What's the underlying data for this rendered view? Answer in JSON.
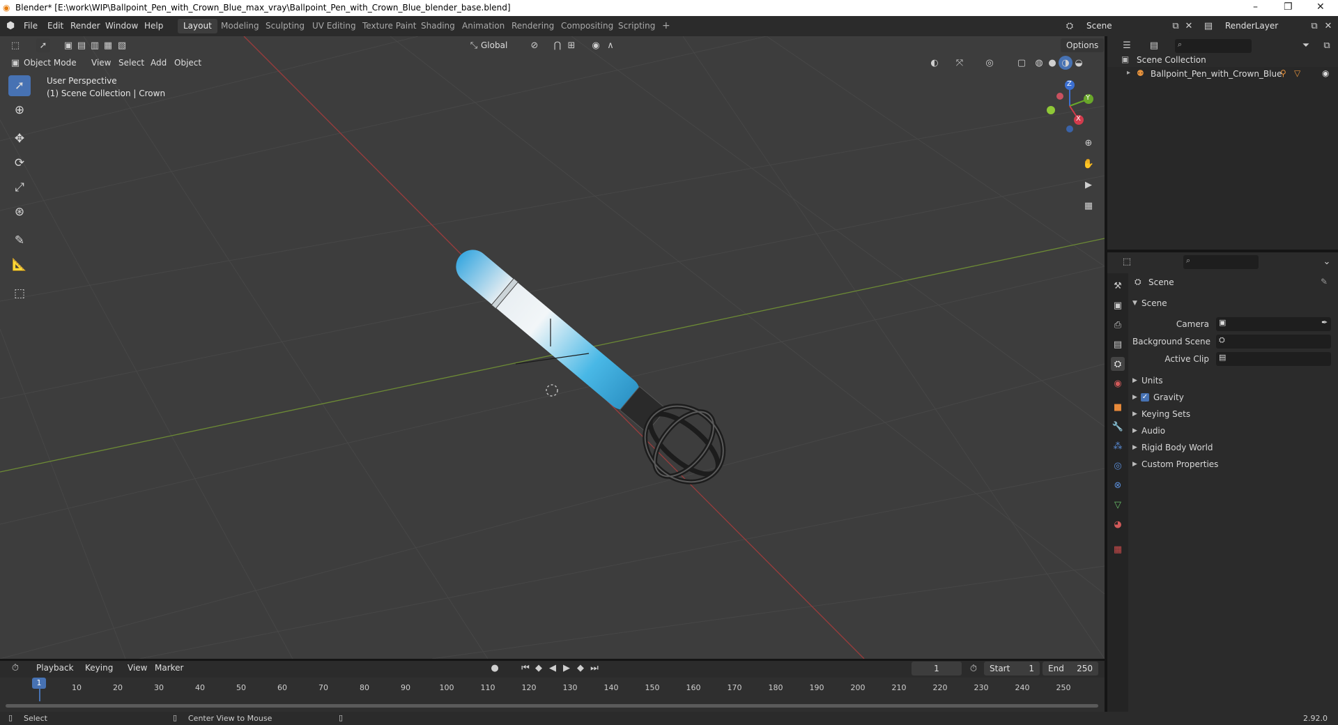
{
  "window": {
    "title": "Blender* [E:\\work\\WIP\\Ballpoint_Pen_with_Crown_Blue_max_vray\\Ballpoint_Pen_with_Crown_Blue_blender_base.blend]",
    "controls": {
      "minimize": "–",
      "maximize": "❐",
      "close": "✕"
    }
  },
  "menu": {
    "items": [
      "File",
      "Edit",
      "Render",
      "Window",
      "Help"
    ]
  },
  "workspaces": {
    "tabs": [
      "Layout",
      "Modeling",
      "Sculpting",
      "UV Editing",
      "Texture Paint",
      "Shading",
      "Animation",
      "Rendering",
      "Compositing",
      "Scripting"
    ],
    "active": "Layout",
    "add": "+"
  },
  "scene_selector": {
    "value": "Scene"
  },
  "render_layer": {
    "value": "RenderLayer"
  },
  "viewport_header": {
    "mode": "Object Mode",
    "menus": [
      "View",
      "Select",
      "Add",
      "Object"
    ],
    "orientation": "Global",
    "options": "Options"
  },
  "viewport": {
    "overlay_title": "User Perspective",
    "overlay_subtitle": "(1) Scene Collection | Crown",
    "gizmo": {
      "x": "X",
      "y": "Y",
      "z": "Z"
    },
    "colors": {
      "background": "#3d3d3d",
      "grid": "#4a4a4a",
      "x_axis": "#b54848",
      "y_axis": "#7a9a3a",
      "active_tool": "#4772b3"
    }
  },
  "outliner": {
    "root": "Scene Collection",
    "items": [
      {
        "label": "Ballpoint_Pen_with_Crown_Blue"
      }
    ]
  },
  "properties": {
    "context": "Scene",
    "panel": "Scene",
    "fields": [
      {
        "label": "Camera",
        "value": ""
      },
      {
        "label": "Background Scene",
        "value": ""
      },
      {
        "label": "Active Clip",
        "value": ""
      }
    ],
    "subpanels": [
      "Units",
      "Gravity",
      "Keying Sets",
      "Audio",
      "Rigid Body World",
      "Custom Properties"
    ],
    "gravity_checked": true
  },
  "timeline": {
    "menus": [
      "Playback",
      "Keying",
      "View",
      "Marker"
    ],
    "current_frame": "1",
    "start_label": "Start",
    "start": "1",
    "end_label": "End",
    "end": "250",
    "ticks": [
      "10",
      "20",
      "30",
      "40",
      "50",
      "60",
      "70",
      "80",
      "90",
      "100",
      "110",
      "120",
      "130",
      "140",
      "150",
      "160",
      "170",
      "180",
      "190",
      "200",
      "210",
      "220",
      "230",
      "240",
      "250"
    ],
    "playhead": "1"
  },
  "statusbar": {
    "left": "Select",
    "middle": "Center View to Mouse",
    "version": "2.92.0"
  }
}
